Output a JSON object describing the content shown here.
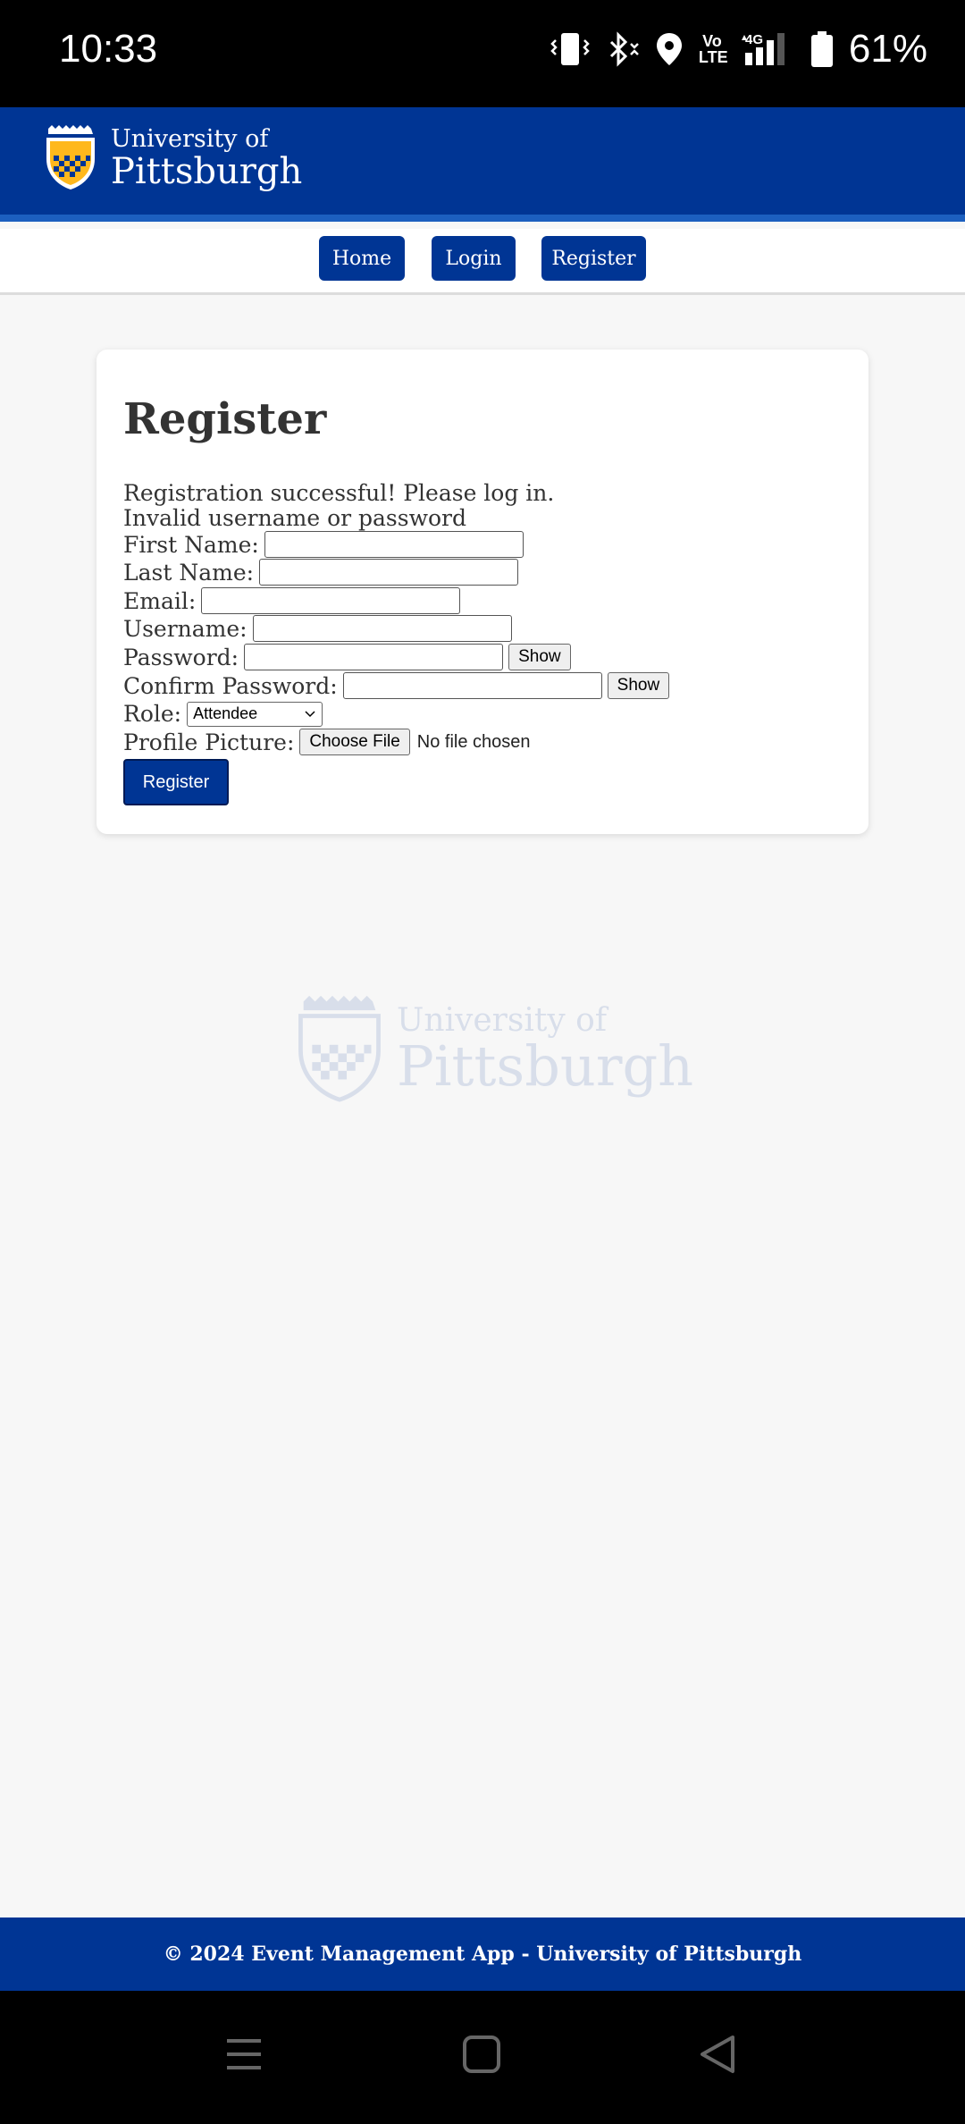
{
  "status_bar": {
    "time": "10:33",
    "battery": "61%",
    "icons": [
      "vibrate-icon",
      "bluetooth-icon",
      "location-icon",
      "volte-icon",
      "4g-signal-icon",
      "battery-icon"
    ],
    "volte_label": "Vo LTE",
    "network_label": "4G"
  },
  "header": {
    "logo_line1": "University of",
    "logo_line2": "Pittsburgh",
    "brand_color": "#003594",
    "gold_color": "#FFB81C"
  },
  "nav": {
    "items": [
      {
        "label": "Home"
      },
      {
        "label": "Login"
      },
      {
        "label": "Register"
      }
    ]
  },
  "form": {
    "title": "Register",
    "messages": [
      "Registration successful! Please log in.",
      "Invalid username or password"
    ],
    "first_name_label": "First Name:",
    "last_name_label": "Last Name:",
    "email_label": "Email:",
    "username_label": "Username:",
    "password_label": "Password:",
    "confirm_password_label": "Confirm Password:",
    "show_label": "Show",
    "role_label": "Role:",
    "role_selected": "Attendee",
    "profile_picture_label": "Profile Picture:",
    "choose_file_label": "Choose File",
    "no_file_text": "No file chosen",
    "submit_label": "Register"
  },
  "footer": {
    "text": "© 2024 Event Management App - University of Pittsburgh"
  },
  "system_nav": {
    "icons": [
      "menu-icon",
      "home-square-icon",
      "back-triangle-icon"
    ]
  }
}
